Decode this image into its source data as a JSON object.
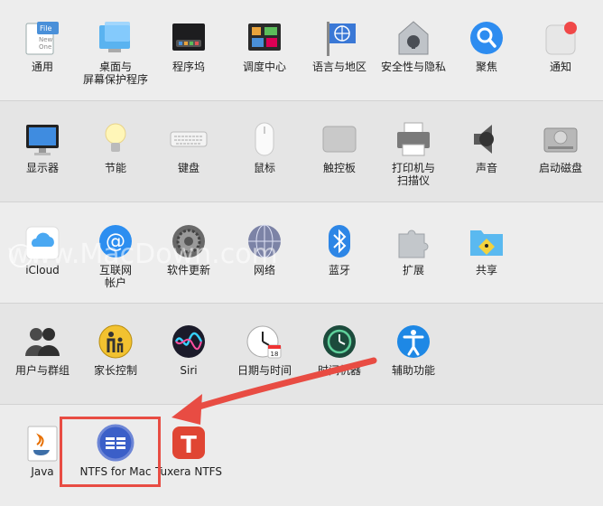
{
  "rows": [
    [
      {
        "id": "general",
        "label": "通用",
        "icon": "general-icon"
      },
      {
        "id": "desktop",
        "label": "桌面与\n屏幕保护程序",
        "icon": "desktop-screensaver-icon"
      },
      {
        "id": "dock",
        "label": "程序坞",
        "icon": "dock-icon"
      },
      {
        "id": "mission",
        "label": "调度中心",
        "icon": "mission-control-icon"
      },
      {
        "id": "language",
        "label": "语言与地区",
        "icon": "language-region-icon"
      },
      {
        "id": "security",
        "label": "安全性与隐私",
        "icon": "security-privacy-icon"
      },
      {
        "id": "spotlight",
        "label": "聚焦",
        "icon": "spotlight-icon"
      },
      {
        "id": "notifications",
        "label": "通知",
        "icon": "notifications-icon"
      }
    ],
    [
      {
        "id": "displays",
        "label": "显示器",
        "icon": "displays-icon"
      },
      {
        "id": "energy",
        "label": "节能",
        "icon": "energy-saver-icon"
      },
      {
        "id": "keyboard",
        "label": "键盘",
        "icon": "keyboard-icon"
      },
      {
        "id": "mouse",
        "label": "鼠标",
        "icon": "mouse-icon"
      },
      {
        "id": "trackpad",
        "label": "触控板",
        "icon": "trackpad-icon"
      },
      {
        "id": "printers",
        "label": "打印机与\n扫描仪",
        "icon": "printer-scanner-icon"
      },
      {
        "id": "sound",
        "label": "声音",
        "icon": "sound-icon"
      },
      {
        "id": "startup",
        "label": "启动磁盘",
        "icon": "startup-disk-icon"
      }
    ],
    [
      {
        "id": "icloud",
        "label": "iCloud",
        "icon": "icloud-icon"
      },
      {
        "id": "internet",
        "label": "互联网\n帐户",
        "icon": "internet-accounts-icon"
      },
      {
        "id": "update",
        "label": "软件更新",
        "icon": "software-update-icon"
      },
      {
        "id": "network",
        "label": "网络",
        "icon": "network-icon"
      },
      {
        "id": "bluetooth",
        "label": "蓝牙",
        "icon": "bluetooth-icon"
      },
      {
        "id": "extensions",
        "label": "扩展",
        "icon": "extensions-icon"
      },
      {
        "id": "sharing",
        "label": "共享",
        "icon": "sharing-icon"
      }
    ],
    [
      {
        "id": "users",
        "label": "用户与群组",
        "icon": "users-groups-icon"
      },
      {
        "id": "parental",
        "label": "家长控制",
        "icon": "parental-controls-icon"
      },
      {
        "id": "siri",
        "label": "Siri",
        "icon": "siri-icon"
      },
      {
        "id": "datetime",
        "label": "日期与时间",
        "icon": "date-time-icon"
      },
      {
        "id": "timemachine",
        "label": "时间机器",
        "icon": "time-machine-icon"
      },
      {
        "id": "accessibility",
        "label": "辅助功能",
        "icon": "accessibility-icon"
      }
    ],
    [
      {
        "id": "java",
        "label": "Java",
        "icon": "java-icon"
      },
      {
        "id": "ntfs",
        "label": "NTFS for Mac",
        "icon": "ntfs-for-mac-icon"
      },
      {
        "id": "tuxera",
        "label": "Tuxera NTFS",
        "icon": "tuxera-ntfs-icon"
      }
    ]
  ],
  "watermark": "www.MacDown.com",
  "colors": {
    "accent": "#e84c43",
    "background": "#ececec"
  }
}
